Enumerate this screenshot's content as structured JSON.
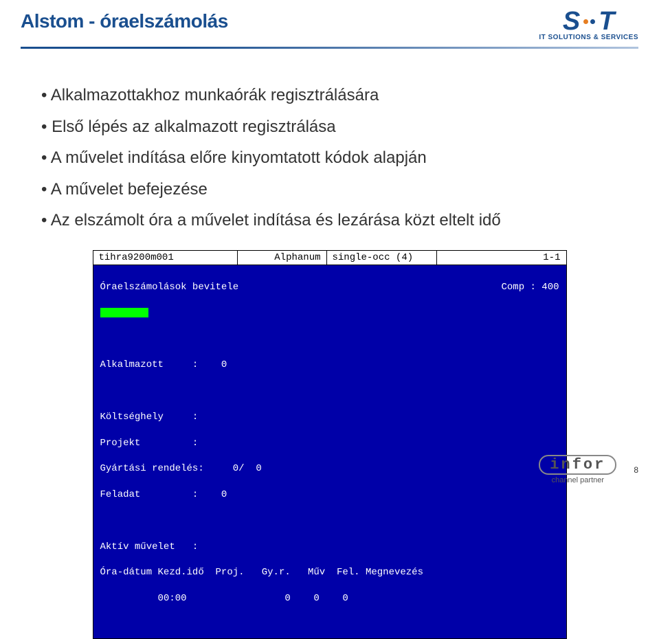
{
  "header": {
    "title": "Alstom - óraelszámolás",
    "logo_letters": {
      "s": "S",
      "t": "T"
    },
    "logo_tagline": "IT SOLUTIONS & SERVICES"
  },
  "bullets": {
    "b1": "Alkalmazottakhoz munkaórák regisztrálására",
    "b2": "Első lépés az alkalmazott regisztrálása",
    "b3": "A művelet indítása előre kinyomtatott kódok alapján",
    "b4": "A művelet befejezése",
    "b5": "Az elszámolt óra a művelet indítása és lezárása közt eltelt idő"
  },
  "terminal": {
    "status": {
      "session": "tihra9200m001",
      "mode": "Alphanum",
      "occ": "single-occ (4)",
      "pos": "1-1"
    },
    "screen_title": "Óraelszámolások bevitele",
    "comp_label": "Comp : 400",
    "fields": {
      "alkalmazott": "Alkalmazott     :    0",
      "koltseghely": "Költséghely     :",
      "projekt": "Projekt         :",
      "gyartasi": "Gyártási rendelés:     0/  0",
      "feladat": "Feladat         :    0",
      "aktiv": "Aktív művelet   :",
      "headers": "Óra-dátum Kezd.idő  Proj.   Gy.r.   Műv  Fel. Megnevezés",
      "row": "          00:00                 0    0    0"
    }
  },
  "footer": {
    "infor_text": "infor",
    "infor_sub": "channel partner",
    "page_number": "8"
  }
}
